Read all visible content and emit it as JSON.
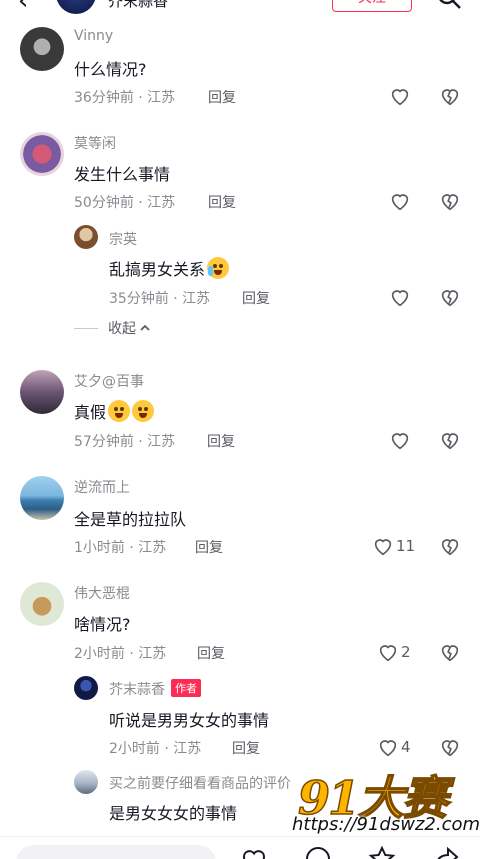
{
  "header": {
    "title": "芥末蒜香",
    "follow_label": "关注"
  },
  "comments": [
    {
      "user": "Vinny",
      "text": "什么情况?",
      "time": "36分钟前 · 江苏",
      "reply": "回复",
      "likes": ""
    },
    {
      "user": "莫等闲",
      "text": "发生什么事情",
      "time": "50分钟前 · 江苏",
      "reply": "回复",
      "likes": ""
    },
    {
      "user": "宗英",
      "text": "乱搞男女关系",
      "time": "35分钟前 · 江苏",
      "reply": "回复",
      "likes": ""
    },
    {
      "user": "艾夕@百事",
      "text": "真假",
      "time": "57分钟前 · 江苏",
      "reply": "回复",
      "likes": ""
    },
    {
      "user": "逆流而上",
      "text": "全是草的拉拉队",
      "time": "1小时前 · 江苏",
      "reply": "回复",
      "likes": "11"
    },
    {
      "user": "伟大恶棍",
      "text": "啥情况?",
      "time": "2小时前 · 江苏",
      "reply": "回复",
      "likes": "2"
    },
    {
      "user": "芥末蒜香",
      "author_tag": "作者",
      "text": "听说是男男女女的事情",
      "time": "2小时前 · 江苏",
      "reply": "回复",
      "likes": "4"
    },
    {
      "user": "买之前要仔细看看商品的评价",
      "text": "是男女女女的事情",
      "time": "",
      "reply": "",
      "likes": ""
    }
  ],
  "collapse_label": "收起",
  "watermark": {
    "logo": "91大赛",
    "url": "https://91dswz2.com"
  },
  "icons": [
    "back-icon",
    "search-icon",
    "heart-icon",
    "dislike-icon",
    "chevron-up-icon",
    "emoji-icon",
    "star-icon",
    "share-icon"
  ],
  "colors": {
    "accent": "#fe2c55",
    "secondary_text": "#8a8b91",
    "primary_text": "#161823"
  }
}
